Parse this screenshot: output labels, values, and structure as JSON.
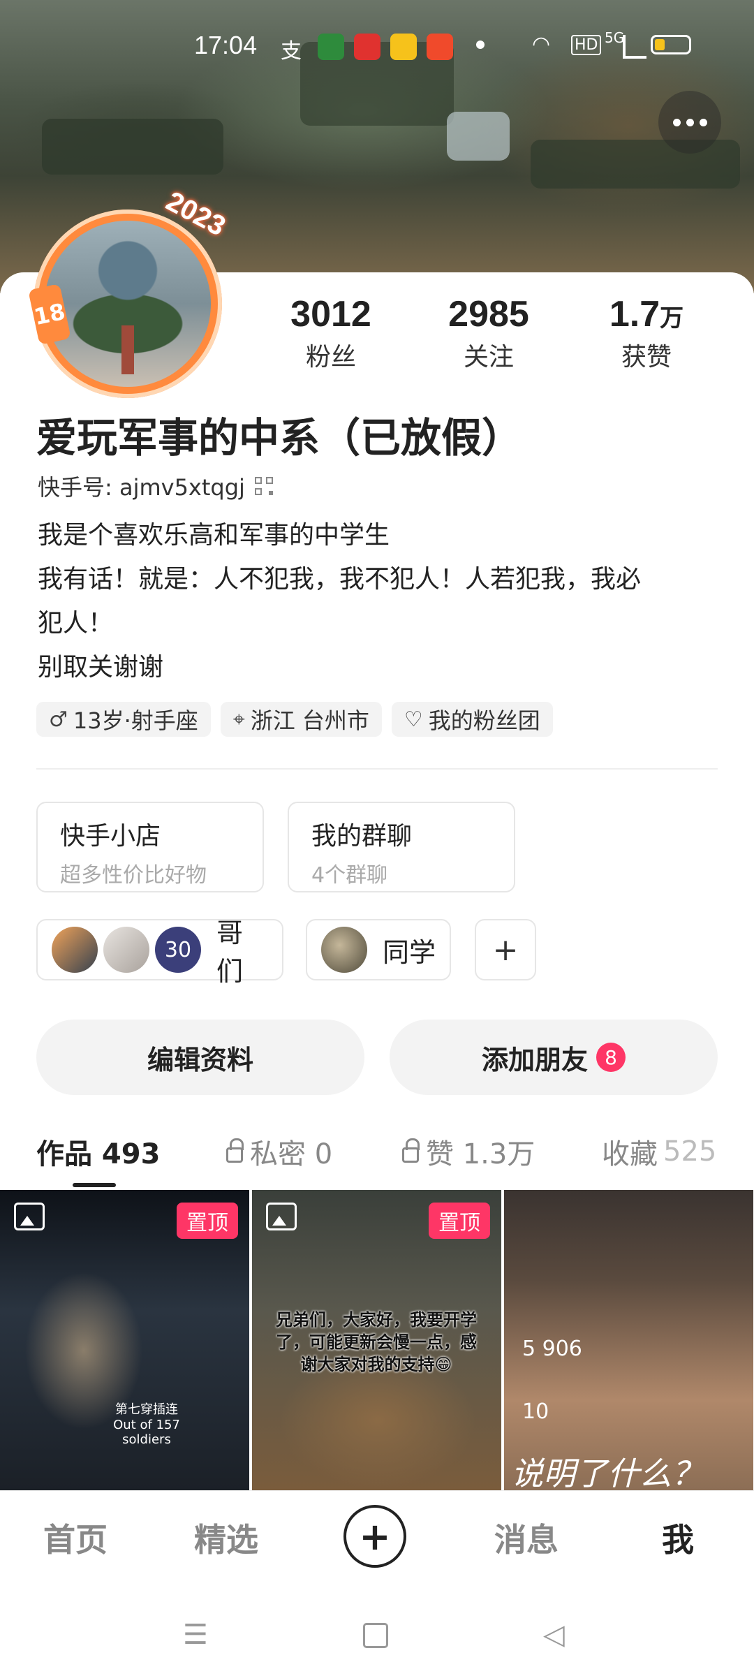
{
  "status_bar": {
    "time": "17:04",
    "network": "5G",
    "hd": "HD"
  },
  "profile": {
    "level_badge": "18",
    "year_badge": "2023",
    "name": "爱玩军事的中系（已放假）",
    "id_label": "快手号: ajmv5xtqgj",
    "bio_lines": [
      "我是个喜欢乐高和军事的中学生",
      "我有话！就是：人不犯我，我不犯人！人若犯我，我必",
      "犯人！",
      "别取关谢谢"
    ],
    "stats": [
      {
        "num": "3012",
        "unit": "",
        "label": "粉丝"
      },
      {
        "num": "2985",
        "unit": "",
        "label": "关注"
      },
      {
        "num": "1.7",
        "unit": "万",
        "label": "获赞"
      }
    ],
    "tags": [
      {
        "icon": "male-icon",
        "glyph": "♂",
        "text": "13岁·射手座"
      },
      {
        "icon": "location-icon",
        "glyph": "⌖",
        "text": "浙江 台州市"
      },
      {
        "icon": "heart-icon",
        "glyph": "♡",
        "text": "我的粉丝团"
      }
    ]
  },
  "tiles": [
    {
      "title": "快手小店",
      "subtitle": "超多性价比好物"
    },
    {
      "title": "我的群聊",
      "subtitle": "4个群聊"
    }
  ],
  "groups": [
    {
      "label": "哥们",
      "count_badge": "30"
    },
    {
      "label": "同学"
    }
  ],
  "add_group": "+",
  "buttons": {
    "edit_profile": "编辑资料",
    "add_friend": "添加朋友",
    "add_friend_count": "8"
  },
  "tabs": [
    {
      "label": "作品 493"
    },
    {
      "label": "私密 0"
    },
    {
      "label": "赞 1.3万"
    },
    {
      "label": "收藏",
      "count": "525"
    }
  ],
  "thumbs": [
    {
      "pinned_label": "置顶",
      "caption": "第七穿插连 Out of 157 soldiers"
    },
    {
      "pinned_label": "置顶",
      "caption": "兄弟们，大家好，我要开学了，可能更新会慢一点，感谢大家对我的支持😁"
    },
    {
      "caption": "说明了什么？",
      "stat1": "5 906",
      "stat2": "10"
    }
  ],
  "bottom_nav": [
    {
      "label": "首页"
    },
    {
      "label": "精选"
    },
    {
      "label": "消息"
    },
    {
      "label": "我"
    }
  ],
  "colors": {
    "accent": "#fe3666",
    "avatar_ring": "#ff8a3d"
  }
}
